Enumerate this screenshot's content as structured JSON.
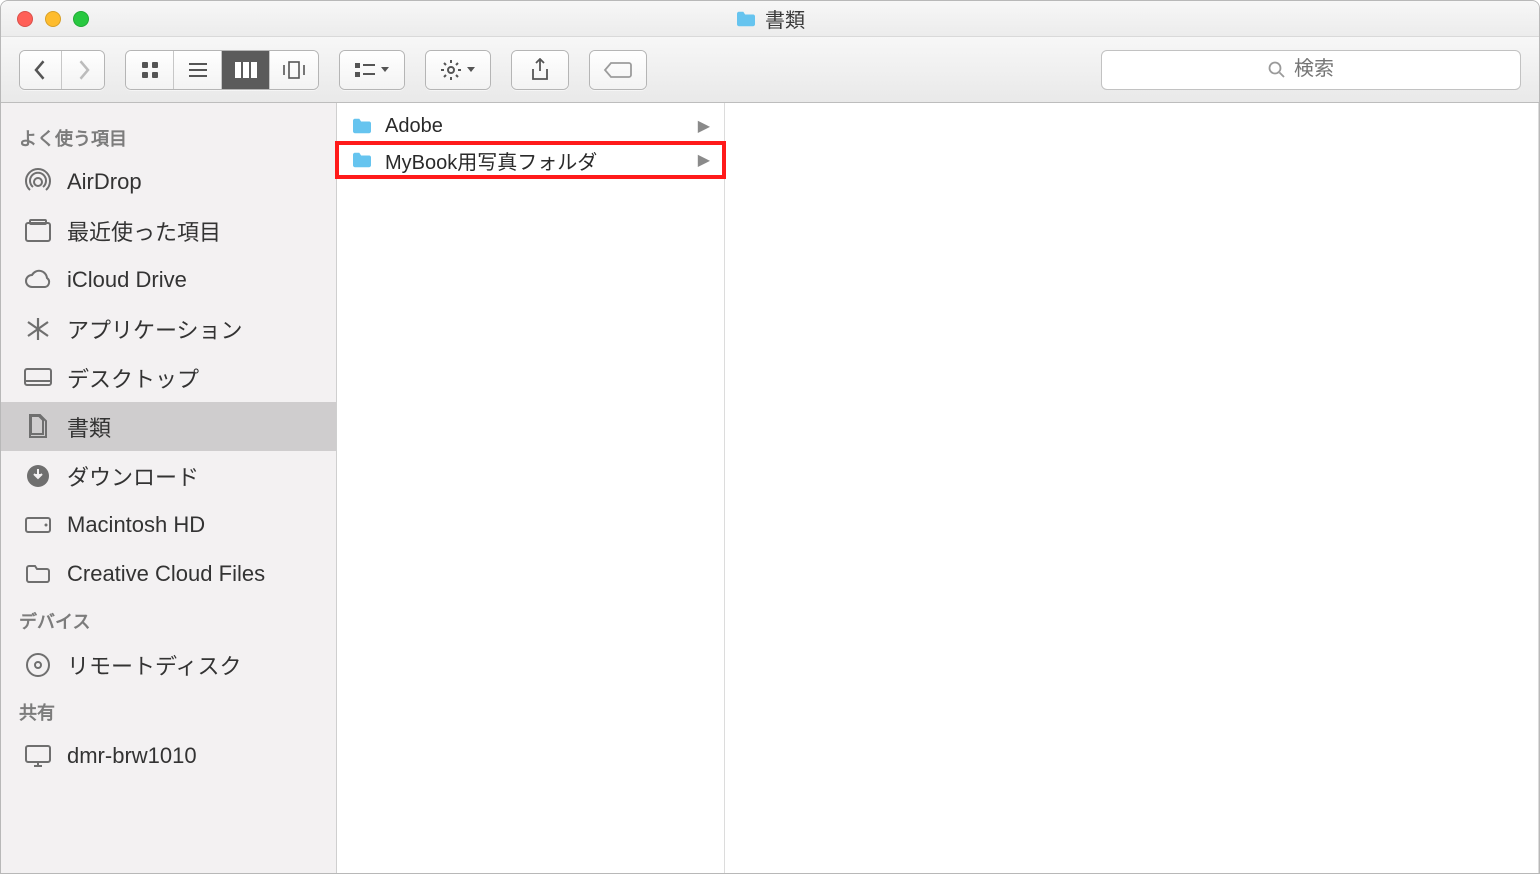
{
  "window": {
    "title": "書類"
  },
  "search": {
    "placeholder": "検索"
  },
  "sidebar": {
    "sections": [
      {
        "header": "よく使う項目",
        "items": [
          {
            "icon": "airdrop",
            "label": "AirDrop",
            "selected": false
          },
          {
            "icon": "recents",
            "label": "最近使った項目",
            "selected": false
          },
          {
            "icon": "icloud",
            "label": "iCloud Drive",
            "selected": false
          },
          {
            "icon": "apps",
            "label": "アプリケーション",
            "selected": false
          },
          {
            "icon": "desktop",
            "label": "デスクトップ",
            "selected": false
          },
          {
            "icon": "documents",
            "label": "書類",
            "selected": true
          },
          {
            "icon": "downloads",
            "label": "ダウンロード",
            "selected": false
          },
          {
            "icon": "hdd",
            "label": "Macintosh HD",
            "selected": false
          },
          {
            "icon": "folder",
            "label": "Creative Cloud Files",
            "selected": false
          }
        ]
      },
      {
        "header": "デバイス",
        "items": [
          {
            "icon": "disc",
            "label": "リモートディスク",
            "selected": false
          }
        ]
      },
      {
        "header": "共有",
        "items": [
          {
            "icon": "monitor",
            "label": "dmr-brw1010",
            "selected": false
          }
        ]
      }
    ]
  },
  "column1": [
    {
      "name": "Adobe",
      "highlighted": false
    },
    {
      "name": "MyBook用写真フォルダ",
      "highlighted": true
    }
  ],
  "highlight_color": "#ff1a1a",
  "folder_color": "#66c4ef"
}
